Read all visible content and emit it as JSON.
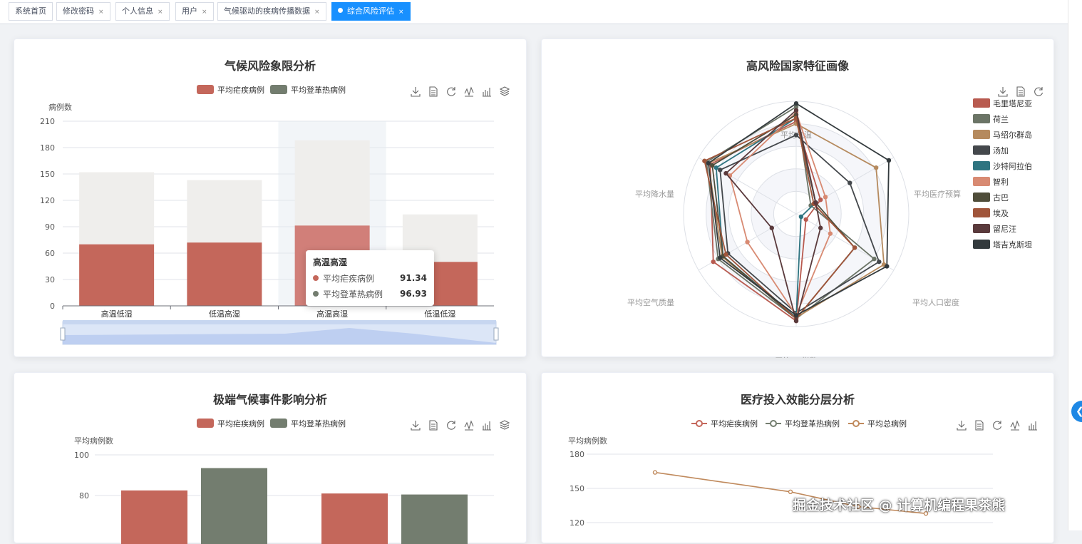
{
  "tabs": [
    {
      "label": "系统首页",
      "closable": false,
      "active": false
    },
    {
      "label": "修改密码",
      "closable": true,
      "active": false
    },
    {
      "label": "个人信息",
      "closable": true,
      "active": false
    },
    {
      "label": "用户",
      "closable": true,
      "active": false
    },
    {
      "label": "气候驱动的疾病传播数据",
      "closable": true,
      "active": false
    },
    {
      "label": "综合风险评估",
      "closable": true,
      "active": true
    }
  ],
  "toolbox_icons": [
    "download-icon",
    "data-view-icon",
    "refresh-icon",
    "line-switch-icon",
    "bar-switch-icon",
    "stack-icon"
  ],
  "colors": {
    "red": "#c4675b",
    "gray": "#737d6f",
    "orange": "#c08a5d",
    "accent": "#1890ff"
  },
  "chart_data": [
    {
      "type": "bar",
      "title": "气候风险象限分析",
      "ylabel": "病例数",
      "categories": [
        "高温低湿",
        "低温高湿",
        "高温高湿",
        "低温低湿"
      ],
      "ylim": [
        0,
        210
      ],
      "yticks": [
        "0",
        "30",
        "60",
        "90",
        "120",
        "150",
        "180",
        "210"
      ],
      "stacked": true,
      "series": [
        {
          "name": "平均疟疾病例",
          "values": [
            70,
            72,
            91.34,
            50
          ]
        },
        {
          "name": "平均登革热病例",
          "values": [
            82,
            71,
            96.93,
            54
          ]
        }
      ],
      "tooltip": {
        "title": "高温高湿",
        "rows": [
          {
            "label": "平均疟疾病例",
            "value": "91.34"
          },
          {
            "label": "平均登革热病例",
            "value": "96.93"
          }
        ]
      },
      "datazoom": true
    },
    {
      "type": "radar",
      "title": "高风险国家特征画像",
      "indicators": [
        "平均气温",
        "平均医疗预算",
        "平均人口密度",
        "平均UV指数",
        "平均空气质量",
        "平均降水量"
      ],
      "series": [
        {
          "name": "毛里塔尼亚",
          "color": "#b85a4f",
          "values": [
            0.82,
            0.25,
            0.1,
            0.95,
            0.85,
            0.88
          ]
        },
        {
          "name": "荷兰",
          "color": "#6b7466",
          "values": [
            0.95,
            0.15,
            0.8,
            0.93,
            0.8,
            0.92
          ]
        },
        {
          "name": "马绍尔群岛",
          "color": "#b58a5e",
          "values": [
            0.8,
            0.82,
            0.9,
            0.92,
            0.76,
            0.9
          ]
        },
        {
          "name": "汤加",
          "color": "#44484c",
          "values": [
            0.7,
            0.55,
            0.85,
            0.88,
            0.7,
            0.78
          ]
        },
        {
          "name": "沙特阿拉伯",
          "color": "#2e7480",
          "values": [
            0.85,
            0.2,
            0.05,
            0.92,
            0.75,
            0.82
          ]
        },
        {
          "name": "智利",
          "color": "#d88a72",
          "values": [
            0.9,
            0.3,
            0.35,
            0.9,
            0.5,
            0.68
          ]
        },
        {
          "name": "古巴",
          "color": "#4f4d3a",
          "values": [
            0.88,
            0.2,
            0.6,
            0.93,
            0.75,
            0.86
          ]
        },
        {
          "name": "埃及",
          "color": "#a0553a",
          "values": [
            0.85,
            0.18,
            0.6,
            0.93,
            0.72,
            0.94
          ]
        },
        {
          "name": "留尼汪",
          "color": "#5a3a3c",
          "values": [
            0.92,
            0.2,
            0.25,
            0.95,
            0.25,
            0.72
          ]
        },
        {
          "name": "塔吉克斯坦",
          "color": "#333a3d",
          "values": [
            0.98,
            0.95,
            0.93,
            0.9,
            0.78,
            0.9
          ]
        }
      ]
    },
    {
      "type": "bar",
      "title": "极端气候事件影响分析",
      "ylabel": "平均病例数",
      "ylim_visible": [
        73,
        100
      ],
      "yticks": [
        "80",
        "100"
      ],
      "series": [
        {
          "name": "平均疟疾病例",
          "values": [
            82.5,
            81
          ]
        },
        {
          "name": "平均登革热病例",
          "values": [
            93.5,
            80.5
          ]
        }
      ]
    },
    {
      "type": "line",
      "title": "医疗投入效能分层分析",
      "ylabel": "平均病例数",
      "ylim_visible": [
        118,
        180
      ],
      "yticks": [
        "120",
        "150",
        "180"
      ],
      "series": [
        {
          "name": "平均疟疾病例",
          "values": []
        },
        {
          "name": "平均登革热病例",
          "values": []
        },
        {
          "name": "平均总病例",
          "values": [
            164,
            147,
            134,
            128
          ]
        }
      ]
    }
  ],
  "watermark": "掘金技术社区 @ 计算机编程果茶熊"
}
